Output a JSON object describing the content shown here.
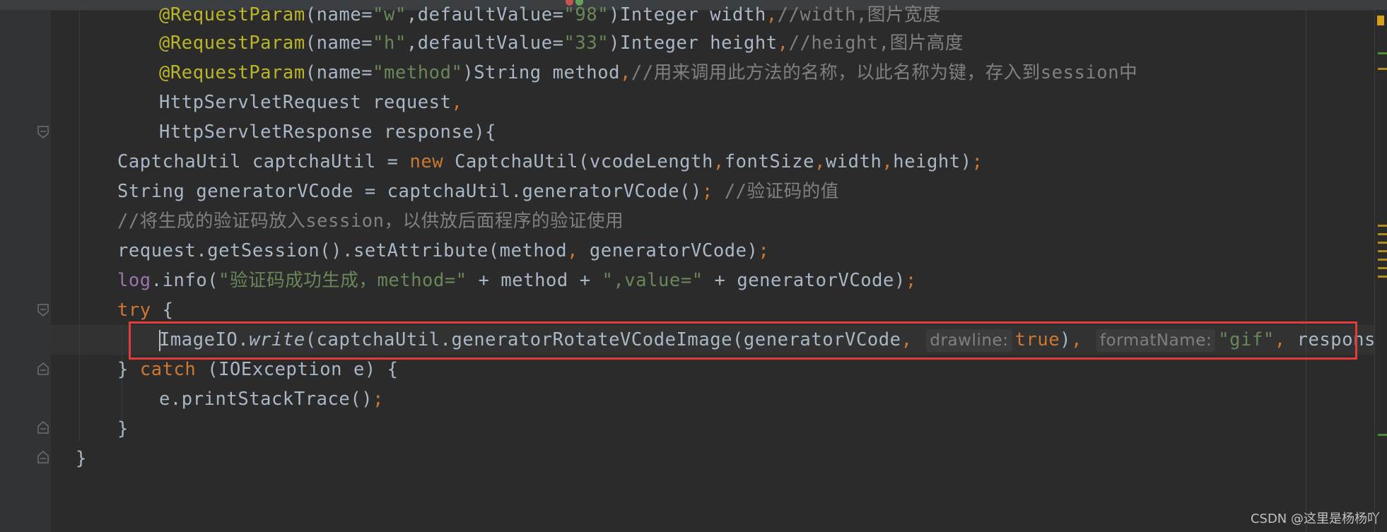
{
  "editor": {
    "lines": {
      "l0": {
        "ann": "@RequestParam",
        "t1": "(name=",
        "s1": "\"w\"",
        "t2": ",defaultValue=",
        "s2": "\"98\"",
        "t3": ")Integer width",
        "k1": ",",
        "c1": "//width,图片宽度"
      },
      "l1": {
        "ann": "@RequestParam",
        "t1": "(name=",
        "s1": "\"h\"",
        "t2": ",defaultValue=",
        "s2": "\"33\"",
        "t3": ")Integer height",
        "k1": ",",
        "c1": "//height,图片高度"
      },
      "l2": {
        "ann": "@RequestParam",
        "t1": "(name=",
        "s1": "\"method\"",
        "t2": ")String method",
        "k1": ",",
        "c1": "//用来调用此方法的名称，以此名称为键，存入到session中"
      },
      "l3": {
        "t1": "HttpServletRequest request",
        "k1": ","
      },
      "l4": {
        "t1": "HttpServletResponse response){"
      },
      "l5": {
        "t1": "CaptchaUtil captchaUtil = ",
        "k1": "new",
        "t2": " CaptchaUtil(vcodeLength",
        "k2": ",",
        "t3": "fontSize",
        "k3": ",",
        "t4": "width",
        "k4": ",",
        "t5": "height)",
        "k5": ";"
      },
      "l6": {
        "t1": "String generatorVCode = captchaUtil.generatorVCode()",
        "k1": ";",
        "c1": " //验证码的值"
      },
      "l7": {
        "c1": "//将生成的验证码放入session，以供放后面程序的验证使用"
      },
      "l8": {
        "t1": "request.getSession().setAttribute(method",
        "k1": ",",
        "t2": " generatorVCode)",
        "k2": ";"
      },
      "l9": {
        "f1": "log",
        "t1": ".info(",
        "s1": "\"验证码成功生成，method=\"",
        "t2": " + method + ",
        "s2": "\",value=\"",
        "t3": " + generatorVCode)",
        "k1": ";"
      },
      "l10": {
        "k1": "try",
        "t1": " {"
      },
      "l11": {
        "t1": "ImageIO.",
        "i1": "write",
        "t2": "(captchaUtil.generatorRotateVCodeImage(generatorVCode",
        "k1": ",",
        "h1": "drawline:",
        "k2": "true",
        "t3": ")",
        "k3": ",",
        "h2": "formatName:",
        "s1": "\"gif\"",
        "k4": ",",
        "t4": " response.getO"
      },
      "l12": {
        "t1": "} ",
        "k1": "catch",
        "t2": " (IOException e) {"
      },
      "l13": {
        "t1": "e.printStackTrace()",
        "k1": ";"
      },
      "l14": {
        "t1": "}"
      },
      "l15": {
        "t1": "}"
      }
    }
  },
  "watermark": "CSDN @这里是杨杨吖",
  "colors": {
    "background": "#2b2b2b",
    "highlight_border": "#e03c3c",
    "keyword": "#cc7832",
    "string": "#6a8759",
    "annotation": "#bbb529",
    "comment": "#808080",
    "field": "#9876aa"
  }
}
